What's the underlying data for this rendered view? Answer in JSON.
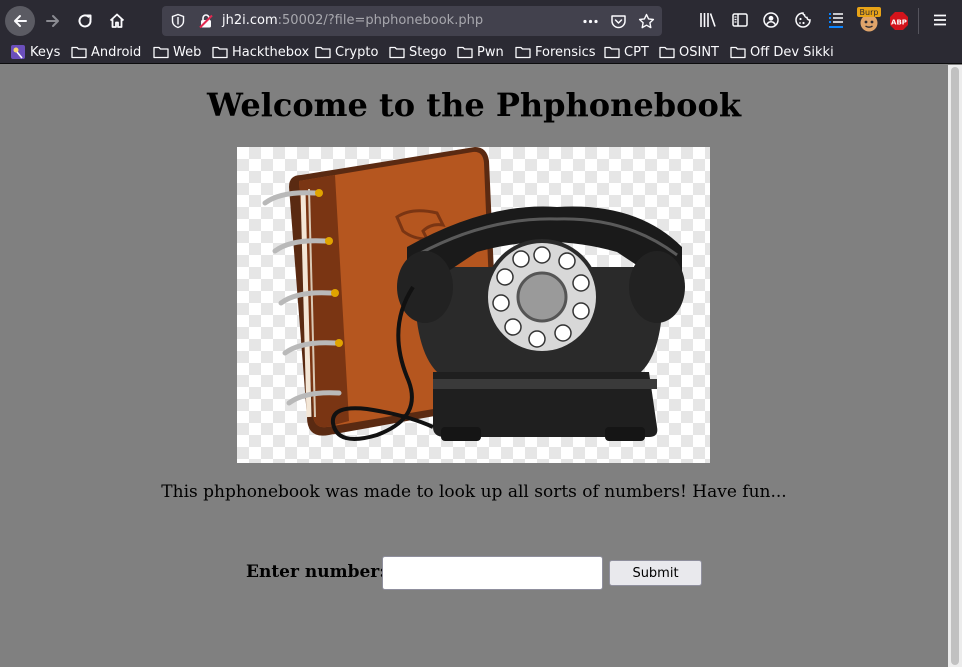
{
  "browser": {
    "url_host": "jh2i.com",
    "url_rest": ":50002/?file=phphonebook.php",
    "burp_badge": "Burp",
    "abp_badge": "ABP"
  },
  "bookmarks": [
    {
      "label": "Keys",
      "icon": "keys-favicon"
    },
    {
      "label": "Android",
      "icon": "folder-icon"
    },
    {
      "label": "Web",
      "icon": "folder-icon"
    },
    {
      "label": "Hackthebox",
      "icon": "folder-icon"
    },
    {
      "label": "Crypto",
      "icon": "folder-icon"
    },
    {
      "label": "Stego",
      "icon": "folder-icon"
    },
    {
      "label": "Pwn",
      "icon": "folder-icon"
    },
    {
      "label": "Forensics",
      "icon": "folder-icon"
    },
    {
      "label": "CPT",
      "icon": "folder-icon"
    },
    {
      "label": "OSINT",
      "icon": "folder-icon"
    },
    {
      "label": "Off Dev Sikki",
      "icon": "folder-icon"
    }
  ],
  "page": {
    "title": "Welcome to the Phphonebook",
    "intro": "This phphonebook was made to look up all sorts of numbers! Have fun...",
    "form": {
      "label": "Enter number:",
      "input_value": "",
      "submit_label": "Submit"
    }
  },
  "colors": {
    "page_background": "#808080",
    "chrome_background": "#2b2a33",
    "book_cover": "#b5561f",
    "phone_body": "#222222"
  }
}
